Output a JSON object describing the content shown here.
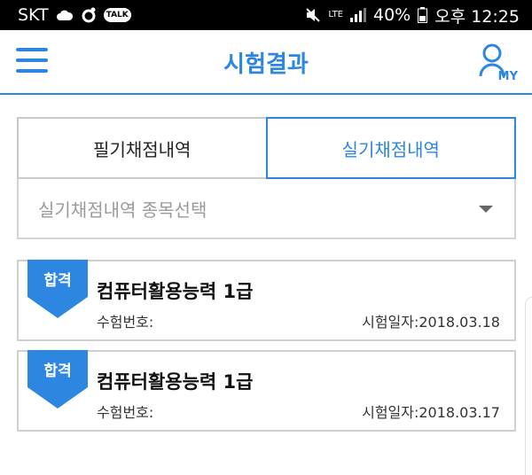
{
  "status_bar": {
    "carrier": "SKT",
    "talk_badge": "TALK",
    "lte": "LTE",
    "battery": "40%",
    "time": "오후 12:25"
  },
  "header": {
    "title": "시험결과",
    "my_label": "MY"
  },
  "tabs": [
    {
      "label": "필기채점내역",
      "active": false
    },
    {
      "label": "실기채점내역",
      "active": true
    }
  ],
  "select": {
    "placeholder": "실기채점내역 종목선택"
  },
  "results": [
    {
      "badge": "합격",
      "exam_name": "컴퓨터활용능력 1급",
      "exam_number_label": "수험번호:",
      "exam_date_label": "시험일자:2018.03.18"
    },
    {
      "badge": "합격",
      "exam_name": "컴퓨터활용능력 1급",
      "exam_number_label": "수험번호:",
      "exam_date_label": "시험일자:2018.03.17"
    }
  ],
  "colors": {
    "accent": "#2d86e0",
    "border": "#d0d0d0",
    "badge": "#2d86e0"
  }
}
